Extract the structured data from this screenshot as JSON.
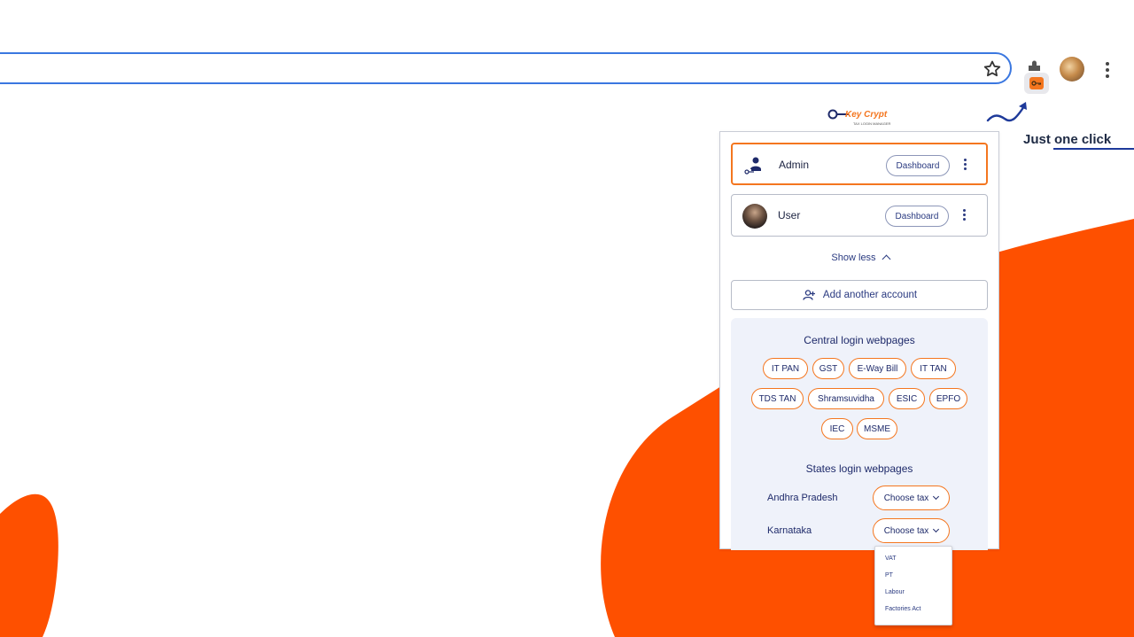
{
  "callout": {
    "text": "Just one click"
  },
  "logo": {
    "brand": "Key Crypt",
    "sub": "TAX LOGIN MANAGER"
  },
  "accounts": [
    {
      "name": "Admin",
      "button": "Dashboard",
      "active": true
    },
    {
      "name": "User",
      "button": "Dashboard",
      "active": false
    }
  ],
  "show_less": "Show less",
  "add_account": "Add another account",
  "central": {
    "title": "Central login webpages",
    "chips": [
      "IT PAN",
      "GST",
      "E-Way Bill",
      "IT TAN",
      "TDS TAN",
      "Shramsuvidha",
      "ESIC",
      "EPFO",
      "IEC",
      "MSME"
    ]
  },
  "states": {
    "title": "States login webpages",
    "rows": [
      {
        "name": "Andhra Pradesh",
        "select": "Choose tax"
      },
      {
        "name": "Karnataka",
        "select": "Choose tax"
      }
    ]
  },
  "dropdown": {
    "options": [
      "VAT",
      "PT",
      "Labour",
      "Factories Act"
    ]
  },
  "colors": {
    "accent": "#f4761f",
    "blob": "#fe5000",
    "navy": "#1e2a6a",
    "omnibox_border": "#3a77e0"
  }
}
